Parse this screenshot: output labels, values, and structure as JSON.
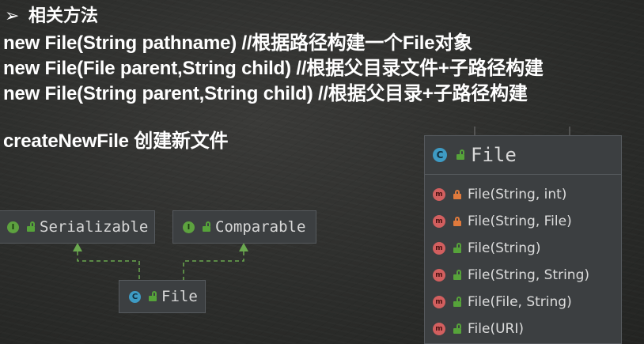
{
  "slide": {
    "heading_bullet": "➢",
    "heading": "相关方法",
    "lines": [
      "new File(String pathname) //根据路径构建一个File对象",
      "new File(File parent,String child) //根据父目录文件+子路径构建",
      "new File(String parent,String child) //根据父目录+子路径构建",
      "createNewFile 创建新文件"
    ]
  },
  "diagram": {
    "interfaces": [
      {
        "icon": "I",
        "name": "Serializable"
      },
      {
        "icon": "I",
        "name": "Comparable"
      }
    ],
    "class_small": {
      "icon": "C",
      "name": "File"
    },
    "class_panel": {
      "icon": "C",
      "name": "File",
      "methods": [
        {
          "icon": "m",
          "access": "private",
          "label": "File(String, int)"
        },
        {
          "icon": "m",
          "access": "private",
          "label": "File(String, File)"
        },
        {
          "icon": "m",
          "access": "public",
          "label": "File(String)"
        },
        {
          "icon": "m",
          "access": "public",
          "label": "File(String, String)"
        },
        {
          "icon": "m",
          "access": "public",
          "label": "File(File, String)"
        },
        {
          "icon": "m",
          "access": "public",
          "label": "File(URI)"
        }
      ]
    }
  },
  "colors": {
    "background": "#2c2d2b",
    "box": "#3c3f41",
    "border": "#565a5e",
    "interface_icon": "#5da23f",
    "class_icon": "#3e9bc4",
    "method_icon": "#d25f5f",
    "link": "#6aa84f"
  }
}
